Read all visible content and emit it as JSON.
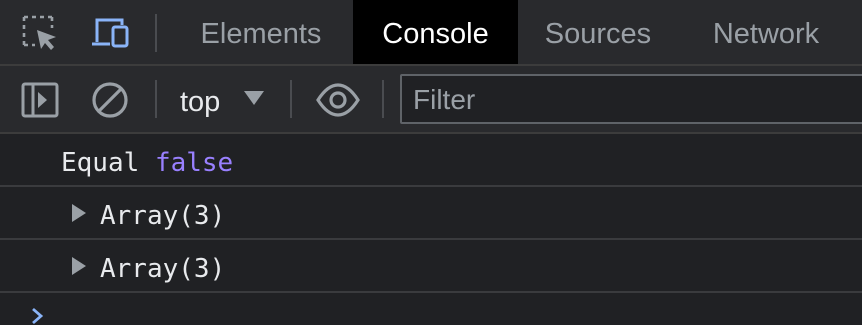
{
  "tabs": {
    "items": [
      {
        "label": "Elements",
        "active": false
      },
      {
        "label": "Console",
        "active": true
      },
      {
        "label": "Sources",
        "active": false
      },
      {
        "label": "Network",
        "active": false
      }
    ],
    "icons": [
      "inspect-element-icon",
      "device-toolbar-icon"
    ]
  },
  "toolbar": {
    "icons": [
      "sidebar-toggle-icon",
      "clear-console-icon",
      "live-expression-eye-icon"
    ],
    "context": "top",
    "filter": {
      "placeholder": "Filter",
      "value": ""
    }
  },
  "console": {
    "messages": [
      {
        "text": "Equal",
        "value": "false"
      },
      {
        "text": "Array(3)",
        "expandable": true
      },
      {
        "text": "Array(3)",
        "expandable": true
      }
    ],
    "prompt_icon": "chevron-right-icon"
  },
  "colors": {
    "background": "#202124",
    "toolbar": "#292a2d",
    "active_tab_bg": "#000000",
    "text": "#e8eaed",
    "muted": "#9aa0a6",
    "boolean": "#9980ff",
    "accent": "#8ab4f8"
  }
}
